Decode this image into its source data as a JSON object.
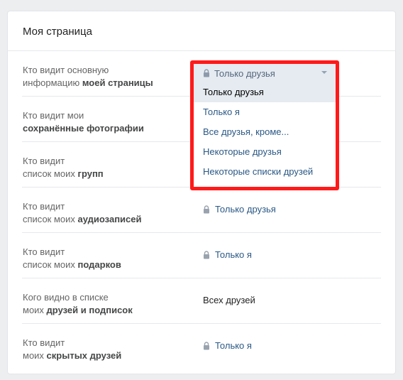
{
  "section": {
    "title": "Моя страница"
  },
  "rows": [
    {
      "label_line1": "Кто видит основную",
      "label_plain2": "информацию ",
      "label_bold2": "моей страницы",
      "value": "Только друзья"
    },
    {
      "label_line1": "Кто видит мои",
      "label_plain2": "",
      "label_bold2": "сохранённые фотографии",
      "value": ""
    },
    {
      "label_line1": "Кто видит",
      "label_plain2": "список моих ",
      "label_bold2": "групп",
      "value": ""
    },
    {
      "label_line1": "Кто видит",
      "label_plain2": "список моих ",
      "label_bold2": "аудиозаписей",
      "value": "Только друзья"
    },
    {
      "label_line1": "Кто видит",
      "label_plain2": "список моих ",
      "label_bold2": "подарков",
      "value": "Только я"
    },
    {
      "label_line1": "Кого видно в списке",
      "label_plain2": "моих ",
      "label_bold2": "друзей и подписок",
      "value": "Всех друзей"
    },
    {
      "label_line1": "Кто видит",
      "label_plain2": "моих ",
      "label_bold2": "скрытых друзей",
      "value": "Только я"
    }
  ],
  "dropdown": {
    "current": "Только друзья",
    "options": [
      "Только друзья",
      "Только я",
      "Все друзья, кроме...",
      "Некоторые друзья",
      "Некоторые списки друзей"
    ],
    "selected_index": 0,
    "highlight_color": "#ff1a1a"
  },
  "icons": {
    "lock": "lock-icon",
    "caret": "caret-down-icon"
  }
}
